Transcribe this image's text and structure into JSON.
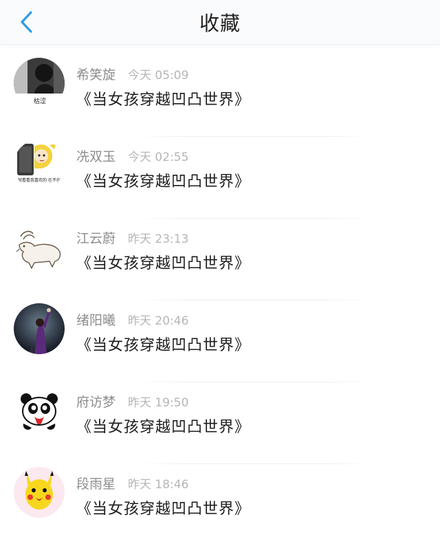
{
  "header": {
    "title": "收藏"
  },
  "items": [
    {
      "name": "希笑旋",
      "time": "今天 05:09",
      "book": "《当女孩穿越凹凸世界》",
      "avatar_text": "枯涩"
    },
    {
      "name": "冼双玉",
      "time": "今天 02:55",
      "book": "《当女孩穿越凹凸世界》",
      "avatar_text": "就看看我喜欢的 在不在"
    },
    {
      "name": "江云蔚",
      "time": "昨天 23:13",
      "book": "《当女孩穿越凹凸世界》"
    },
    {
      "name": "绪阳曦",
      "time": "昨天 20:46",
      "book": "《当女孩穿越凹凸世界》"
    },
    {
      "name": "府访梦",
      "time": "昨天 19:50",
      "book": "《当女孩穿越凹凸世界》"
    },
    {
      "name": "段雨星",
      "time": "昨天 18:46",
      "book": "《当女孩穿越凹凸世界》"
    }
  ],
  "colors": {
    "accent": "#2d9be8",
    "name": "#8d8d8d",
    "time": "#b6b6b6",
    "text": "#1e1e1e"
  },
  "icons": {
    "back": "chevron-left-icon"
  }
}
